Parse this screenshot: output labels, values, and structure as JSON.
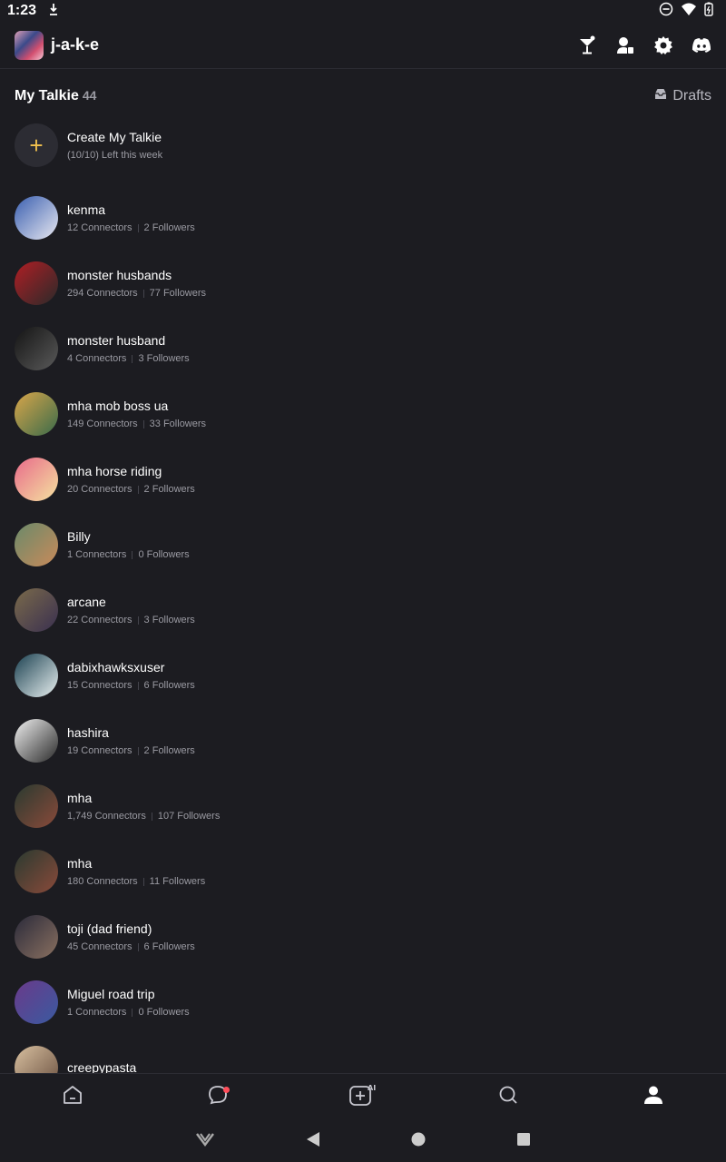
{
  "status": {
    "time": "1:23"
  },
  "header": {
    "username": "j-a-k-e"
  },
  "section": {
    "title": "My Talkie",
    "count": "44",
    "drafts_label": "Drafts"
  },
  "create": {
    "label": "Create My Talkie",
    "sub": "(10/10) Left this week"
  },
  "talkies": [
    {
      "name": "kenma",
      "connectors": "12 Connectors",
      "followers": "2 Followers",
      "color": "#3a5fb0",
      "color2": "#e8e8f0"
    },
    {
      "name": "monster husbands",
      "connectors": "294 Connectors",
      "followers": "77 Followers",
      "color": "#b01e24",
      "color2": "#2a2a2a"
    },
    {
      "name": "monster husband",
      "connectors": "4 Connectors",
      "followers": "3 Followers",
      "color": "#141414",
      "color2": "#5a5a5a"
    },
    {
      "name": "mha mob boss ua",
      "connectors": "149 Connectors",
      "followers": "33 Followers",
      "color": "#d9a64a",
      "color2": "#3a6b4a"
    },
    {
      "name": "mha horse riding",
      "connectors": "20 Connectors",
      "followers": "2 Followers",
      "color": "#e86a8a",
      "color2": "#f5e2a0"
    },
    {
      "name": "Billy",
      "connectors": "1 Connectors",
      "followers": "0 Followers",
      "color": "#6a8a6a",
      "color2": "#c88a5a"
    },
    {
      "name": "arcane",
      "connectors": "22 Connectors",
      "followers": "3 Followers",
      "color": "#7a6a4a",
      "color2": "#3a3050"
    },
    {
      "name": "dabixhawksxuser",
      "connectors": "15 Connectors",
      "followers": "6 Followers",
      "color": "#1a4050",
      "color2": "#e8f0f0"
    },
    {
      "name": "hashira",
      "connectors": "19 Connectors",
      "followers": "2 Followers",
      "color": "#f0f0f0",
      "color2": "#2a2a2a"
    },
    {
      "name": "mha",
      "connectors": "1,749 Connectors",
      "followers": "107 Followers",
      "color": "#2a3a30",
      "color2": "#8a4a3a"
    },
    {
      "name": "mha",
      "connectors": "180 Connectors",
      "followers": "11 Followers",
      "color": "#2a3a30",
      "color2": "#8a4a3a"
    },
    {
      "name": "toji (dad friend)",
      "connectors": "45 Connectors",
      "followers": "6 Followers",
      "color": "#2a2a3a",
      "color2": "#8a7060"
    },
    {
      "name": "Miguel road trip",
      "connectors": "1 Connectors",
      "followers": "0 Followers",
      "color": "#6a3a8a",
      "color2": "#3a5aa0"
    },
    {
      "name": "creepypasta",
      "connectors": "",
      "followers": "",
      "color": "#d8c0a0",
      "color2": "#6a5040"
    }
  ],
  "nav": {
    "active": "profile",
    "chat_has_badge": true,
    "accent": "#ff4d5a"
  }
}
